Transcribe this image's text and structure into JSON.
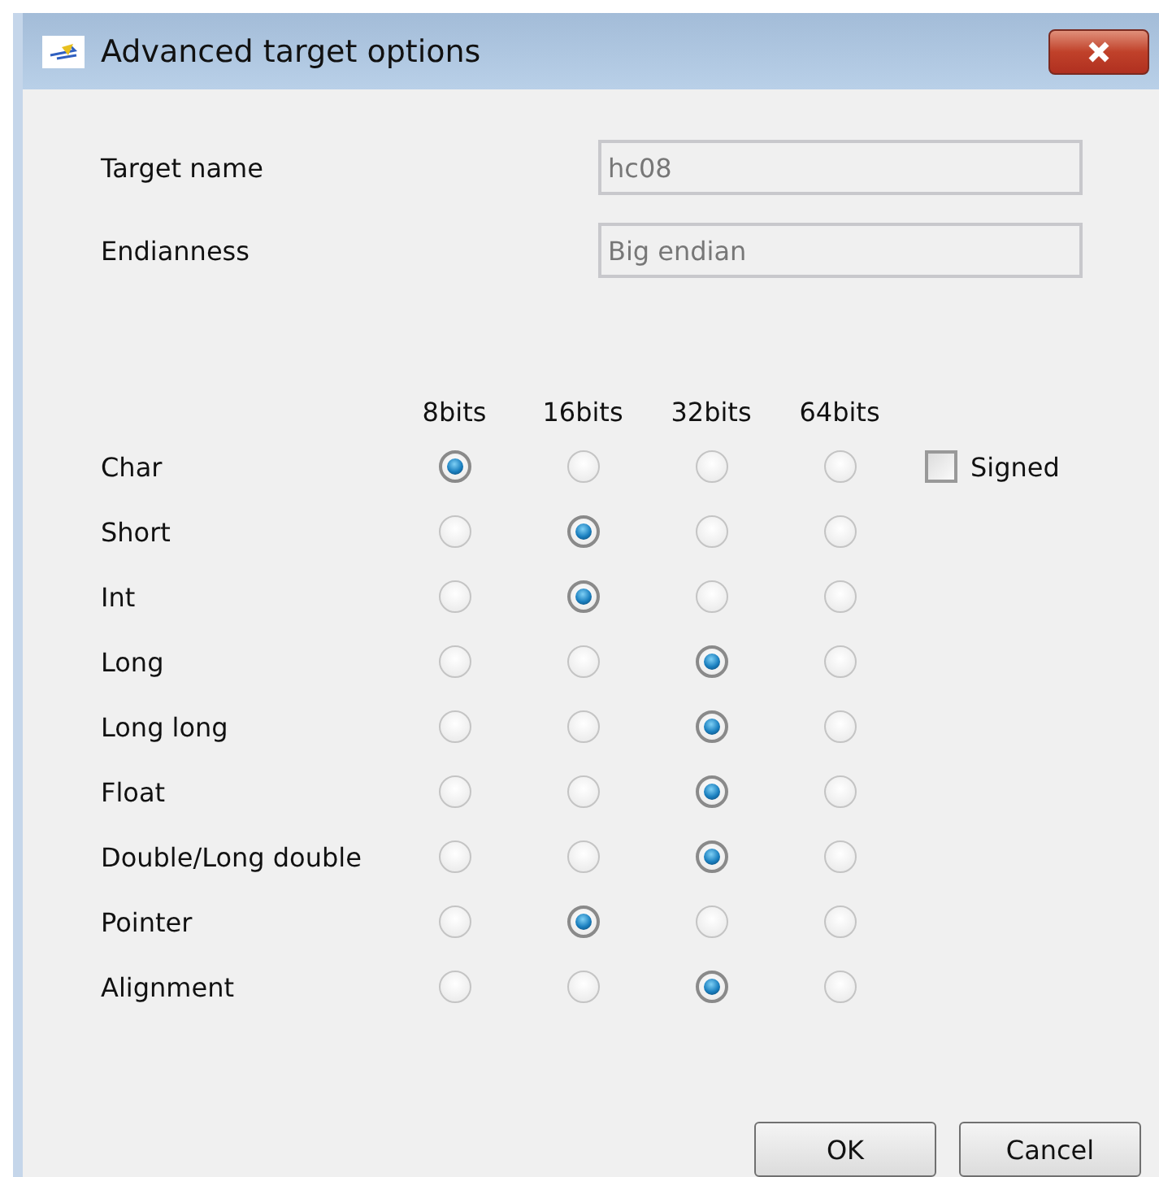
{
  "window": {
    "title": "Advanced target options"
  },
  "fields": [
    {
      "label": "Target name",
      "value": "hc08",
      "disabled": true
    },
    {
      "label": "Endianness",
      "value": "Big endian",
      "disabled": true
    }
  ],
  "columns": [
    "8bits",
    "16bits",
    "32bits",
    "64bits"
  ],
  "rows": [
    {
      "label": "Char",
      "options": [
        {
          "selected": true
        },
        {
          "selected": false
        },
        {
          "selected": false
        },
        {
          "selected": false
        }
      ],
      "checkbox": {
        "label": "Signed",
        "checked": false
      }
    },
    {
      "label": "Short",
      "options": [
        {
          "selected": false
        },
        {
          "selected": true
        },
        {
          "selected": false
        },
        {
          "selected": false
        }
      ]
    },
    {
      "label": "Int",
      "options": [
        {
          "selected": false
        },
        {
          "selected": true
        },
        {
          "selected": false
        },
        {
          "selected": false
        }
      ]
    },
    {
      "label": "Long",
      "options": [
        {
          "selected": false
        },
        {
          "selected": false
        },
        {
          "selected": true
        },
        {
          "selected": false
        }
      ]
    },
    {
      "label": "Long long",
      "options": [
        {
          "selected": false
        },
        {
          "selected": false
        },
        {
          "selected": true
        },
        {
          "selected": false
        }
      ]
    },
    {
      "label": "Float",
      "options": [
        {
          "selected": false
        },
        {
          "selected": false
        },
        {
          "selected": true
        },
        {
          "selected": false
        }
      ]
    },
    {
      "label": "Double/Long double",
      "options": [
        {
          "selected": false
        },
        {
          "selected": false
        },
        {
          "selected": true
        },
        {
          "selected": false
        }
      ]
    },
    {
      "label": "Pointer",
      "options": [
        {
          "selected": false
        },
        {
          "selected": true
        },
        {
          "selected": false
        },
        {
          "selected": false
        }
      ]
    },
    {
      "label": "Alignment",
      "options": [
        {
          "selected": false
        },
        {
          "selected": false
        },
        {
          "selected": true
        },
        {
          "selected": false
        }
      ]
    }
  ],
  "buttons": [
    "OK",
    "Cancel"
  ]
}
